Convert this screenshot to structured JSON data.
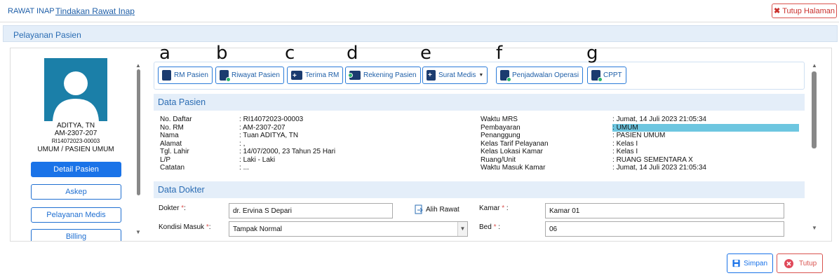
{
  "breadcrumb": {
    "section": "RAWAT INAP",
    "current": "Tindakan Rawat Inap"
  },
  "close_page": "Tutup Halaman",
  "panel_title": "Pelayanan Pasien",
  "patient": {
    "name": "ADITYA, TN",
    "rm": "AM-2307-207",
    "reg": "RI14072023-00003",
    "payer": "UMUM / PASIEN UMUM"
  },
  "side_buttons": [
    "Detail Pasien",
    "Askep",
    "Pelayanan Medis",
    "Billing"
  ],
  "toolbar": [
    "RM Pasien",
    "Riwayat Pasien",
    "Terima RM",
    "Rekening Pasien",
    "Surat Medis",
    "Penjadwalan Operasi",
    "CPPT"
  ],
  "letters": [
    "a",
    "b",
    "c",
    "d",
    "e",
    "f",
    "g"
  ],
  "data_pasien": {
    "title": "Data Pasien",
    "left": [
      {
        "label": "No. Daftar",
        "value": "RI14072023-00003"
      },
      {
        "label": "No. RM",
        "value": "AM-2307-207"
      },
      {
        "label": "Nama",
        "value": "Tuan ADITYA, TN"
      },
      {
        "label": "Alamat",
        "value": ","
      },
      {
        "label": "Tgl. Lahir",
        "value": "14/07/2000, 23 Tahun 25 Hari"
      },
      {
        "label": "L/P",
        "value": "Laki - Laki"
      },
      {
        "label": "Catatan",
        "value": "..."
      }
    ],
    "right": [
      {
        "label": "Waktu MRS",
        "value": "Jumat, 14 Juli 2023 21:05:34"
      },
      {
        "label": "Pembayaran",
        "value": "UMUM"
      },
      {
        "label": "Penanggung",
        "value": "PASIEN UMUM"
      },
      {
        "label": "Kelas Tarif Pelayanan",
        "value": "Kelas I"
      },
      {
        "label": "Kelas Lokasi Kamar",
        "value": "Kelas I"
      },
      {
        "label": "Ruang/Unit",
        "value": "RUANG SEMENTARA X"
      },
      {
        "label": "Waktu Masuk Kamar",
        "value": "Jumat, 14 Juli 2023 21:05:34"
      }
    ]
  },
  "data_dokter": {
    "title": "Data Dokter",
    "dokter_label": "Dokter",
    "dokter_value": "dr. Ervina S Depari",
    "alih_rawat": "Alih Rawat",
    "kamar_label": "Kamar",
    "kamar_value": "Kamar 01",
    "kondisi_label": "Kondisi Masuk",
    "kondisi_value": "Tampak Normal",
    "bed_label": "Bed",
    "bed_value": "06"
  },
  "footer": {
    "save": "Simpan",
    "close": "Tutup"
  },
  "colors": {
    "accent": "#1a73e8",
    "header_bg": "#e4eef9",
    "danger": "#d9534f"
  }
}
